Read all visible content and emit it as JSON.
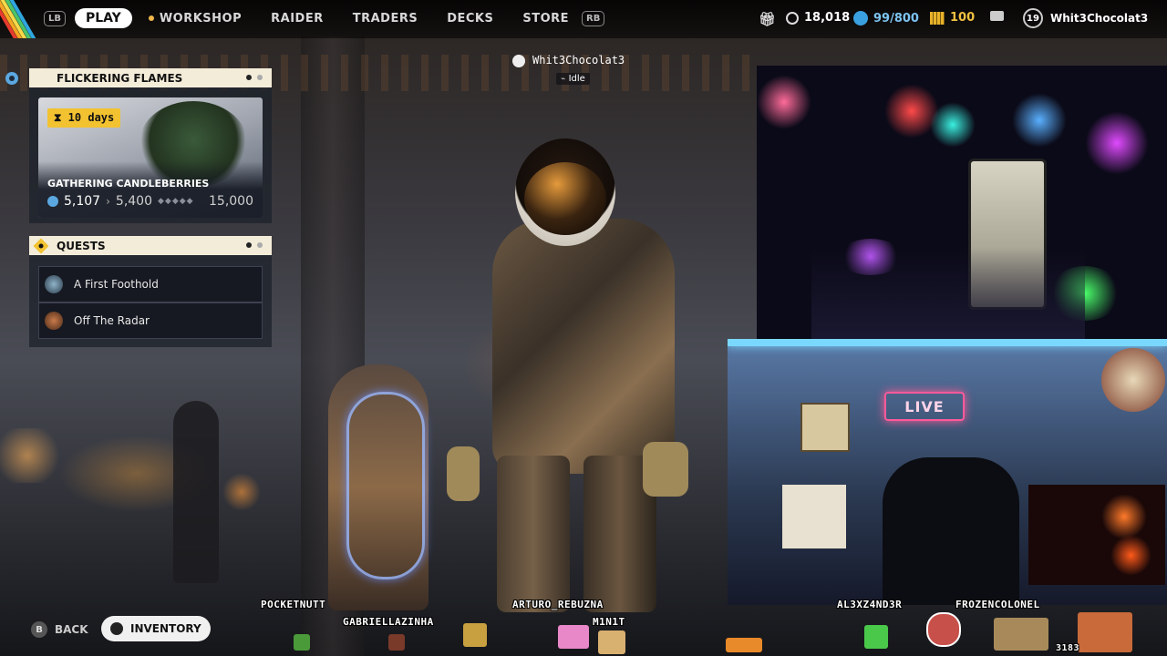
{
  "nav": {
    "lb": "LB",
    "play": "PLAY",
    "items": [
      "WORKSHOP",
      "RAIDER",
      "TRADERS",
      "DECKS",
      "STORE"
    ],
    "rb": "RB"
  },
  "resources": {
    "credits": "18,018",
    "capacity": "99/800",
    "coins": "100",
    "level": "19",
    "username": "Whit3Chocolat3"
  },
  "player": {
    "name": "Whit3Chocolat3",
    "status": "Idle"
  },
  "event_panel": {
    "title": "FLICKERING FLAMES",
    "timer": "10 days",
    "event_name": "GATHERING CANDLEBERRIES",
    "current": "5,107",
    "next": "5,400",
    "max": "15,000",
    "progress_fraction": 0.34
  },
  "quests_panel": {
    "title": "QUESTS",
    "items": [
      {
        "label": "A First Foothold"
      },
      {
        "label": "Off The Radar"
      }
    ]
  },
  "bottom": {
    "b_key": "B",
    "back_label": "BACK",
    "inventory_label": "INVENTORY"
  },
  "stream_overlay": {
    "chatters": [
      "POCKETNUTT",
      "GABRIELLAZINHA",
      "ARTURO_REBUZNA",
      "M1N1T",
      "AL3XZ4ND3R",
      "FROZENCOLONEL"
    ],
    "sign": "LIVE",
    "counter": "3183"
  },
  "colors": {
    "accent_cream": "#f3ecd9",
    "timer_yellow": "#f2c230",
    "credit_blue": "#3aa0e0",
    "coin_gold": "#e8b22a"
  },
  "icons": {
    "event": "gear-icon",
    "quests": "diamond-icon",
    "timer": "hourglass-icon",
    "profile": "crown-icon"
  }
}
